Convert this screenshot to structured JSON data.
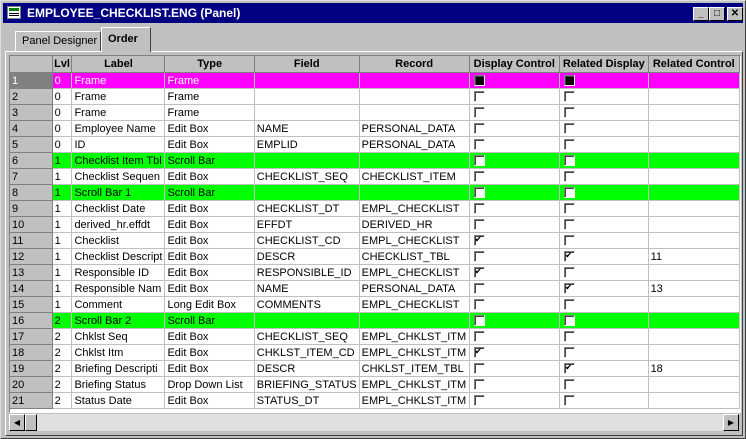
{
  "window": {
    "title": "EMPLOYEE_CHECKLIST.ENG (Panel)",
    "minimize": "_",
    "maximize": "□",
    "close": "✕"
  },
  "tabs": [
    {
      "label": "Panel Designer",
      "active": false
    },
    {
      "label": "Order",
      "active": true
    }
  ],
  "columns": [
    "",
    "Lvl",
    "Label",
    "Type",
    "Field",
    "Record",
    "Display Control",
    "Related Display",
    "Related Control"
  ],
  "rows": [
    {
      "n": "1",
      "lvl": "0",
      "label": "Frame",
      "type": "Frame",
      "field": "",
      "record": "",
      "dc": "filled",
      "rd": "filled",
      "rc": "",
      "style": "magenta",
      "selected": true
    },
    {
      "n": "2",
      "lvl": "0",
      "label": "Frame",
      "type": "Frame",
      "field": "",
      "record": "",
      "dc": "off",
      "rd": "off",
      "rc": "",
      "style": ""
    },
    {
      "n": "3",
      "lvl": "0",
      "label": "Frame",
      "type": "Frame",
      "field": "",
      "record": "",
      "dc": "off",
      "rd": "off",
      "rc": "",
      "style": ""
    },
    {
      "n": "4",
      "lvl": "0",
      "label": "Employee Name",
      "type": "Edit Box",
      "field": "NAME",
      "record": "PERSONAL_DATA",
      "dc": "off",
      "rd": "off",
      "rc": "",
      "style": ""
    },
    {
      "n": "5",
      "lvl": "0",
      "label": "ID",
      "type": "Edit Box",
      "field": "EMPLID",
      "record": "PERSONAL_DATA",
      "dc": "off",
      "rd": "off",
      "rc": "",
      "style": ""
    },
    {
      "n": "6",
      "lvl": "1",
      "label": "Checklist Item Tbl",
      "type": "Scroll Bar",
      "field": "",
      "record": "",
      "dc": "off",
      "rd": "off",
      "rc": "",
      "style": "green"
    },
    {
      "n": "7",
      "lvl": "1",
      "label": "Checklist Sequen",
      "type": "Edit Box",
      "field": "CHECKLIST_SEQ",
      "record": "CHECKLIST_ITEM",
      "dc": "off",
      "rd": "off",
      "rc": "",
      "style": ""
    },
    {
      "n": "8",
      "lvl": "1",
      "label": "Scroll Bar 1",
      "type": "Scroll Bar",
      "field": "",
      "record": "",
      "dc": "off",
      "rd": "off",
      "rc": "",
      "style": "green"
    },
    {
      "n": "9",
      "lvl": "1",
      "label": "Checklist Date",
      "type": "Edit Box",
      "field": "CHECKLIST_DT",
      "record": "EMPL_CHECKLIST",
      "dc": "off",
      "rd": "off",
      "rc": "",
      "style": ""
    },
    {
      "n": "10",
      "lvl": "1",
      "label": "derived_hr.effdt",
      "type": "Edit Box",
      "field": "EFFDT",
      "record": "DERIVED_HR",
      "dc": "off",
      "rd": "off",
      "rc": "",
      "style": ""
    },
    {
      "n": "11",
      "lvl": "1",
      "label": "Checklist",
      "type": "Edit Box",
      "field": "CHECKLIST_CD",
      "record": "EMPL_CHECKLIST",
      "dc": "on",
      "rd": "off",
      "rc": "",
      "style": ""
    },
    {
      "n": "12",
      "lvl": "1",
      "label": "Checklist Descript",
      "type": "Edit Box",
      "field": "DESCR",
      "record": "CHECKLIST_TBL",
      "dc": "off",
      "rd": "on",
      "rc": "11",
      "style": ""
    },
    {
      "n": "13",
      "lvl": "1",
      "label": "Responsible ID",
      "type": "Edit Box",
      "field": "RESPONSIBLE_ID",
      "record": "EMPL_CHECKLIST",
      "dc": "on",
      "rd": "off",
      "rc": "",
      "style": ""
    },
    {
      "n": "14",
      "lvl": "1",
      "label": "Responsible Nam",
      "type": "Edit Box",
      "field": "NAME",
      "record": "PERSONAL_DATA",
      "dc": "off",
      "rd": "on",
      "rc": "13",
      "style": ""
    },
    {
      "n": "15",
      "lvl": "1",
      "label": "Comment",
      "type": "Long Edit Box",
      "field": "COMMENTS",
      "record": "EMPL_CHECKLIST",
      "dc": "off",
      "rd": "off",
      "rc": "",
      "style": ""
    },
    {
      "n": "16",
      "lvl": "2",
      "label": "Scroll Bar 2",
      "type": "Scroll Bar",
      "field": "",
      "record": "",
      "dc": "off",
      "rd": "off",
      "rc": "",
      "style": "green"
    },
    {
      "n": "17",
      "lvl": "2",
      "label": "Chklst Seq",
      "type": "Edit Box",
      "field": "CHECKLIST_SEQ",
      "record": "EMPL_CHKLST_ITM",
      "dc": "off",
      "rd": "off",
      "rc": "",
      "style": ""
    },
    {
      "n": "18",
      "lvl": "2",
      "label": "Chklst Itm",
      "type": "Edit Box",
      "field": "CHKLST_ITEM_CD",
      "record": "EMPL_CHKLST_ITM",
      "dc": "on",
      "rd": "off",
      "rc": "",
      "style": ""
    },
    {
      "n": "19",
      "lvl": "2",
      "label": "Briefing Descripti",
      "type": "Edit Box",
      "field": "DESCR",
      "record": "CHKLST_ITEM_TBL",
      "dc": "off",
      "rd": "on",
      "rc": "18",
      "style": ""
    },
    {
      "n": "20",
      "lvl": "2",
      "label": "Briefing Status",
      "type": "Drop Down List",
      "field": "BRIEFING_STATUS",
      "record": "EMPL_CHKLST_ITM",
      "dc": "off",
      "rd": "off",
      "rc": "",
      "style": ""
    },
    {
      "n": "21",
      "lvl": "2",
      "label": "Status Date",
      "type": "Edit Box",
      "field": "STATUS_DT",
      "record": "EMPL_CHKLST_ITM",
      "dc": "off",
      "rd": "off",
      "rc": "",
      "style": ""
    }
  ],
  "scrollbar": {
    "left": "◀",
    "right": "▶"
  },
  "colors": {
    "title_bg": "#000080",
    "highlight_magenta": "#ff00ff",
    "highlight_green": "#00ff00",
    "face": "#c0c0c0"
  }
}
